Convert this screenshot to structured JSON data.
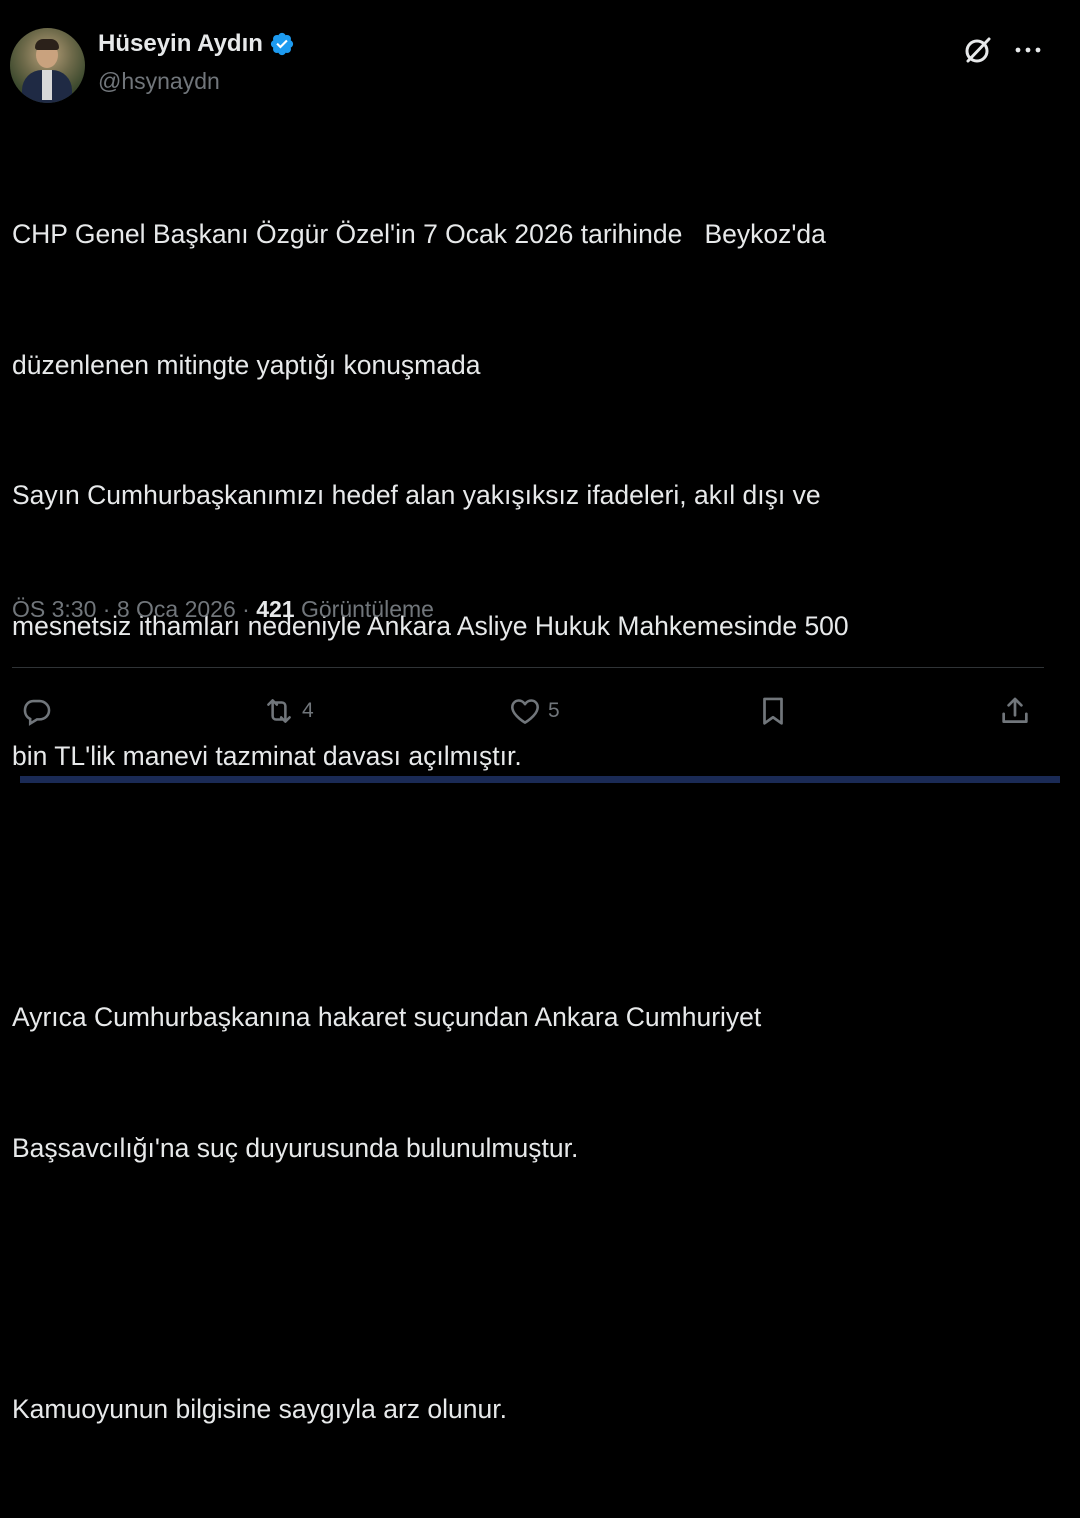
{
  "author": {
    "display_name": "Hüseyin Aydın",
    "handle": "@hsynaydn",
    "verified": true
  },
  "tweet": {
    "paragraphs": [
      [
        "CHP Genel Başkanı Özgür Özel'in 7 Ocak 2026 tarihinde   Beykoz'da",
        "düzenlenen mitingte yaptığı konuşmada",
        "Sayın Cumhurbaşkanımızı hedef alan yakışıksız ifadeleri, akıl dışı ve",
        "mesnetsiz ithamları nedeniyle Ankara Asliye Hukuk Mahkemesinde 500",
        "bin TL'lik manevi tazminat davası açılmıştır."
      ],
      [
        "Ayrıca Cumhurbaşkanına hakaret suçundan Ankara Cumhuriyet",
        "Başsavcılığı'na suç duyurusunda bulunulmuştur."
      ],
      [
        "Kamuoyunun bilgisine saygıyla arz olunur."
      ]
    ]
  },
  "meta": {
    "time": "ÖS 3:30",
    "separator": "·",
    "date": "8 Oca 2026",
    "views_count": "421",
    "views_label": "Görüntüleme"
  },
  "actions": {
    "reply_count": "",
    "repost_count": "4",
    "like_count": "5"
  },
  "icons": {
    "header": [
      "grok-icon",
      "more-icon"
    ],
    "actions": [
      "reply-icon",
      "repost-icon",
      "like-icon",
      "bookmark-icon",
      "share-icon"
    ]
  },
  "colors": {
    "background": "#000000",
    "text": "#e7e9ea",
    "secondary": "#71767b",
    "verified": "#1d9bf0",
    "divider": "#2f3336"
  }
}
